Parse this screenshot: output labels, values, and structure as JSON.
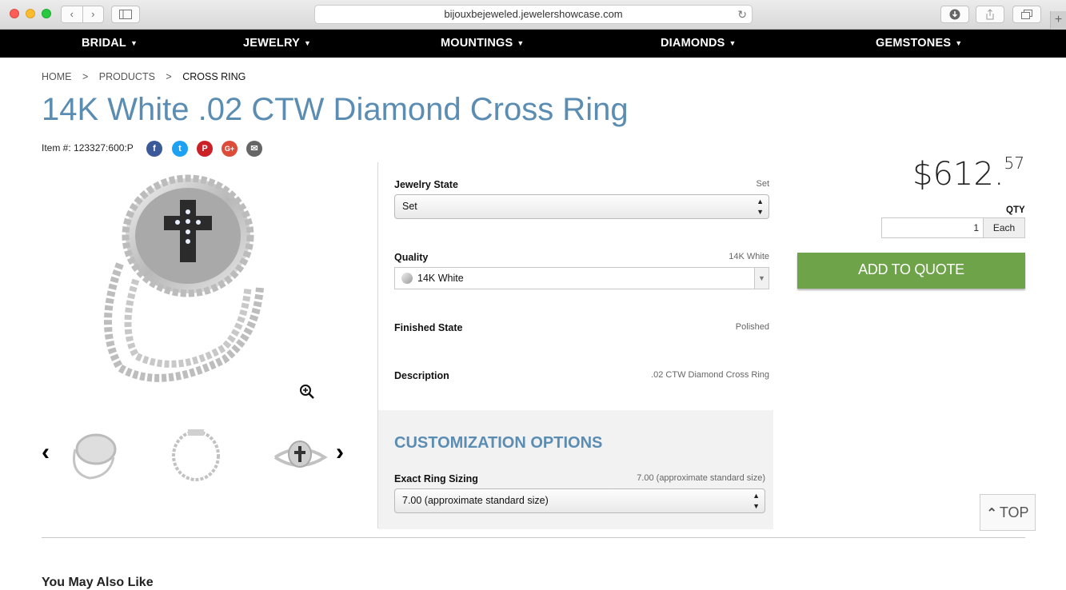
{
  "browser": {
    "url": "bijouxbejeweled.jewelershowcase.com"
  },
  "nav": {
    "items": [
      {
        "label": "BRIDAL"
      },
      {
        "label": "JEWELRY"
      },
      {
        "label": "MOUNTINGS"
      },
      {
        "label": "DIAMONDS"
      },
      {
        "label": "GEMSTONES"
      }
    ]
  },
  "breadcrumb": {
    "home": "HOME",
    "sep": ">",
    "products": "PRODUCTS",
    "current": "CROSS RING"
  },
  "product": {
    "title": "14K White .02 CTW Diamond Cross Ring",
    "item_number": "Item #: 123327:600:P",
    "price_main": "$612.",
    "price_cents": "57",
    "qty_label": "QTY",
    "qty_value": "1",
    "qty_unit": "Each",
    "add_button": "ADD TO QUOTE"
  },
  "social": [
    {
      "icon": "facebook-icon",
      "glyph": "f",
      "color": "#3b5998"
    },
    {
      "icon": "twitter-icon",
      "glyph": "t",
      "color": "#1da1f2"
    },
    {
      "icon": "pinterest-icon",
      "glyph": "P",
      "color": "#cb2027"
    },
    {
      "icon": "google-plus-icon",
      "glyph": "G+",
      "color": "#dd4b39"
    },
    {
      "icon": "email-icon",
      "glyph": "✉",
      "color": "#666666"
    }
  ],
  "options": {
    "jewelry_state": {
      "label": "Jewelry State",
      "value": "Set",
      "selected": "Set"
    },
    "quality": {
      "label": "Quality",
      "value": "14K White",
      "selected": "14K White"
    },
    "finished_state": {
      "label": "Finished State",
      "value": "Polished"
    },
    "description": {
      "label": "Description",
      "value": ".02 CTW Diamond Cross Ring"
    }
  },
  "customization": {
    "title": "CUSTOMIZATION OPTIONS",
    "ring_sizing": {
      "label": "Exact Ring Sizing",
      "value": "7.00 (approximate standard size)",
      "selected": "7.00 (approximate standard size)"
    }
  },
  "top_button": "TOP",
  "also_like": "You May Also Like"
}
